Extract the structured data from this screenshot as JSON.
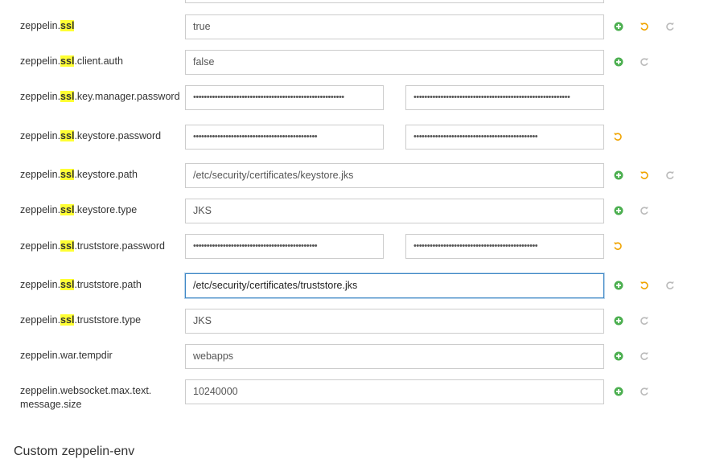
{
  "highlight": "ssl",
  "colors": {
    "add": "#4caf50",
    "undo": "#f0a400",
    "redo": "#bbbbbb"
  },
  "properties": [
    {
      "prefix": "zeppelin.",
      "rest": "",
      "value": "true",
      "actions": [
        "add-icon",
        "undo-icon",
        "redo-icon"
      ]
    },
    {
      "prefix": "zeppelin.",
      "rest": ".client.auth",
      "value": "false",
      "actions": [
        "add-icon",
        "redo-icon"
      ]
    },
    {
      "prefix": "zeppelin.",
      "rest": ".key.manager.password",
      "value": "••••••••••••••••••••••••••••••••••••••••••••••••••••••••",
      "confirm": "••••••••••••••••••••••••••••••••••••••••••••••••••••••••••",
      "actions": []
    },
    {
      "prefix": "zeppelin.",
      "rest": ".keystore.password",
      "value": "••••••••••••••••••••••••••••••••••••••••••••••",
      "confirm": "••••••••••••••••••••••••••••••••••••••••••••••",
      "actions": [
        "undo-icon"
      ]
    },
    {
      "prefix": "zeppelin.",
      "rest": ".keystore.path",
      "value": "/etc/security/certificates/keystore.jks",
      "actions": [
        "add-icon",
        "undo-icon",
        "redo-icon"
      ]
    },
    {
      "prefix": "zeppelin.",
      "rest": ".keystore.type",
      "value": "JKS",
      "actions": [
        "add-icon",
        "redo-icon"
      ]
    },
    {
      "prefix": "zeppelin.",
      "rest": ".truststore.password",
      "value": "••••••••••••••••••••••••••••••••••••••••••••••",
      "confirm": "••••••••••••••••••••••••••••••••••••••••••••••",
      "actions": [
        "undo-icon"
      ]
    },
    {
      "prefix": "zeppelin.",
      "rest": ".truststore.path",
      "value": "/etc/security/certificates/truststore.jks",
      "actions": [
        "add-icon",
        "undo-icon",
        "redo-icon"
      ]
    },
    {
      "prefix": "zeppelin.",
      "rest": ".truststore.type",
      "value": "JKS",
      "actions": [
        "add-icon",
        "redo-icon"
      ]
    },
    {
      "prefix": "zeppelin.war.tempdir",
      "value": "webapps",
      "actions": [
        "add-icon",
        "redo-icon"
      ]
    },
    {
      "prefix": "zeppelin.websocket.max.text.",
      "line2": "message.size",
      "value": "10240000",
      "actions": [
        "add-icon",
        "redo-icon"
      ]
    }
  ],
  "section": {
    "title": "Custom zeppelin-env"
  }
}
